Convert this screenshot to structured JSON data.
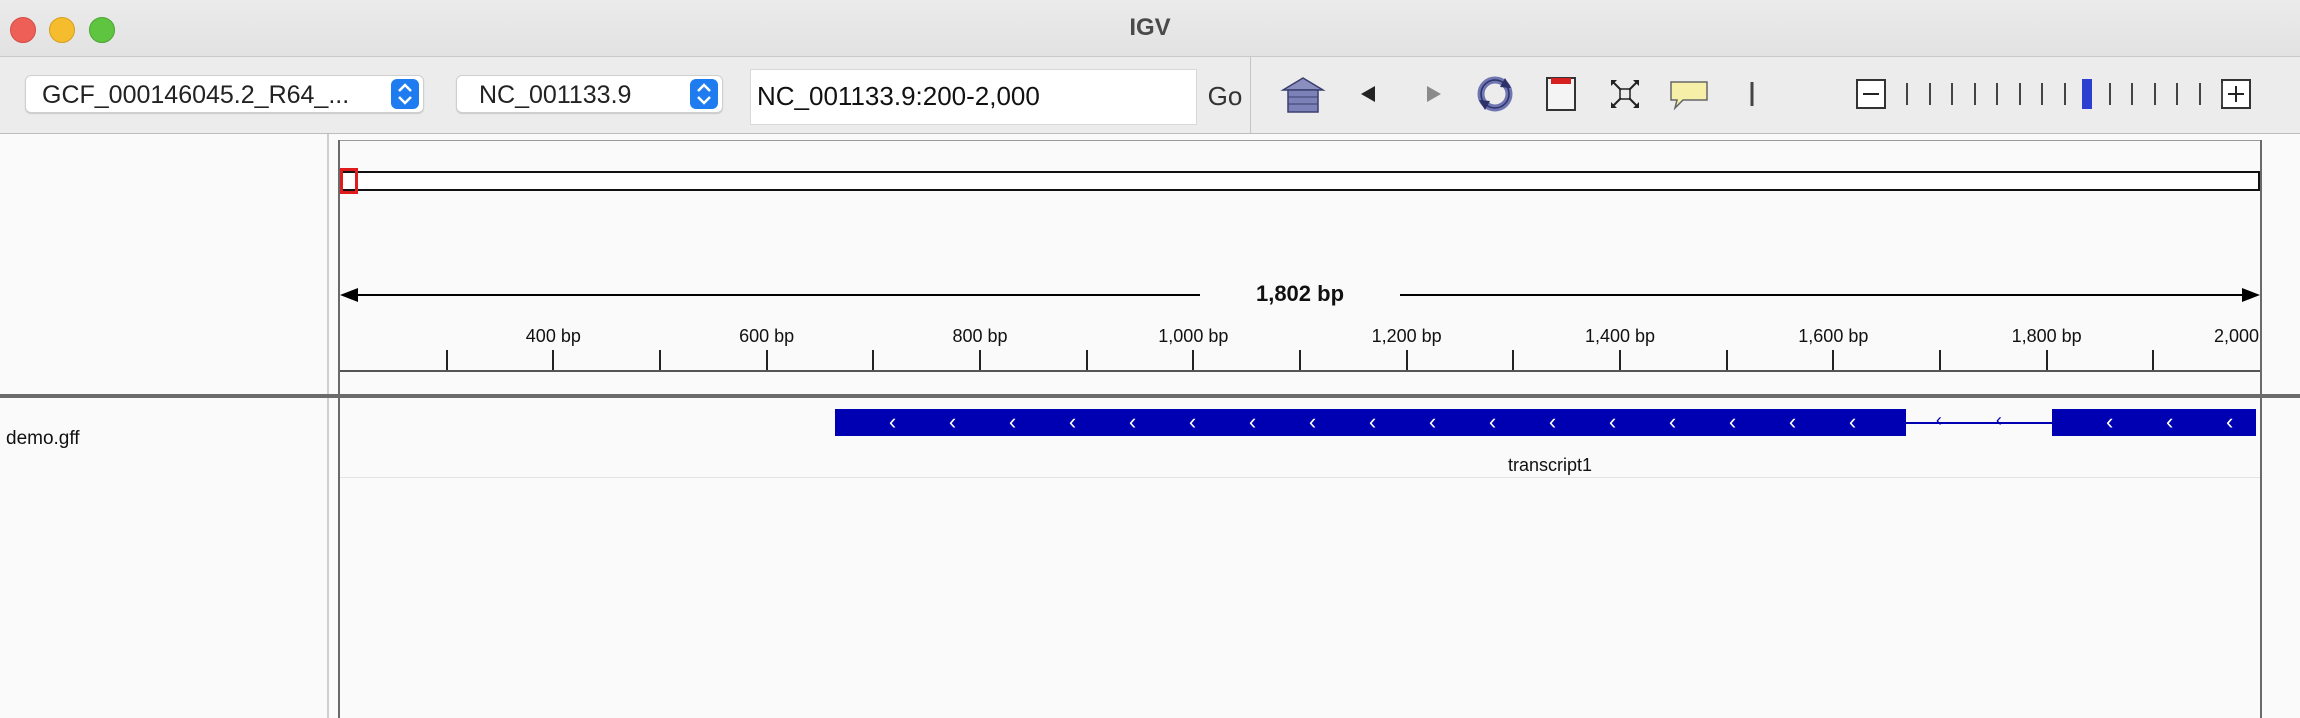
{
  "window": {
    "title": "IGV"
  },
  "toolbar": {
    "genome_select": "GCF_000146045.2_R64_...",
    "chromosome_select": "NC_001133.9",
    "locus_value": "NC_001133.9:200-2,000",
    "go_label": "Go",
    "zoom_level_index": 8,
    "zoom_level_count": 15
  },
  "ruler": {
    "span_label": "1,802 bp",
    "tick_labels": [
      "400 bp",
      "600 bp",
      "800 bp",
      "1,000 bp",
      "1,200 bp",
      "1,400 bp",
      "1,600 bp",
      "1,800 bp",
      "2,000 bp"
    ],
    "view_start_bp": 200,
    "view_end_bp": 2000
  },
  "tracks": [
    {
      "name": "demo.gff",
      "feature_label": "transcript1",
      "strand": "-",
      "exons_bp": [
        [
          664,
          1668
        ],
        [
          1805,
          2000
        ]
      ],
      "color": "#0000b3"
    }
  ],
  "colors": {
    "feature": "#0000b3",
    "ideogram_marker": "#e01b1b",
    "stepper": "#1f7cf0",
    "zoom_indicator": "#2b3fd1"
  },
  "icons": {
    "home": "home-icon",
    "back": "back-arrow-icon",
    "forward": "forward-arrow-icon",
    "refresh": "refresh-icon",
    "region_of_interest": "region-of-interest-icon",
    "resize_to_window": "fit-window-icon",
    "popup_text": "popup-balloon-icon",
    "ruler_line": "ruler-icon",
    "zoom_out": "zoom-out-icon",
    "zoom_in": "zoom-in-icon"
  }
}
